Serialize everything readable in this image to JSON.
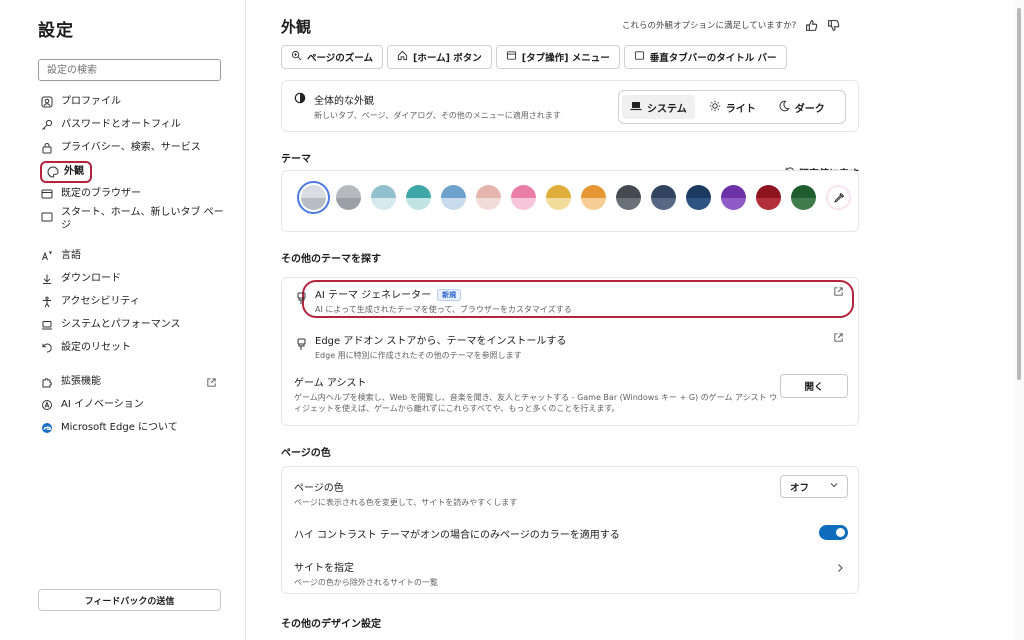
{
  "sidebar": {
    "title": "設定",
    "search_placeholder": "設定の検索",
    "items": [
      {
        "label": "プロファイル",
        "icon": "profile-icon"
      },
      {
        "label": "パスワードとオートフィル",
        "icon": "key-icon"
      },
      {
        "label": "プライバシー、検索、サービス",
        "icon": "lock-icon"
      },
      {
        "label": "外観",
        "icon": "palette-icon"
      },
      {
        "label": "既定のブラウザー",
        "icon": "browser-icon"
      },
      {
        "label": "スタート、ホーム、新しいタブ ページ",
        "icon": "home-tab-icon"
      },
      {
        "label": "言語",
        "icon": "language-icon"
      },
      {
        "label": "ダウンロード",
        "icon": "download-icon"
      },
      {
        "label": "アクセシビリティ",
        "icon": "accessibility-icon"
      },
      {
        "label": "システムとパフォーマンス",
        "icon": "laptop-icon"
      },
      {
        "label": "設定のリセット",
        "icon": "reset-icon"
      },
      {
        "label": "拡張機能",
        "icon": "puzzle-icon"
      },
      {
        "label": "AI イノベーション",
        "icon": "ai-icon"
      },
      {
        "label": "Microsoft Edge について",
        "icon": "edge-logo-icon"
      }
    ],
    "feedback_label": "フィードバックの送信"
  },
  "main": {
    "title": "外観",
    "satisfaction_text": "これらの外観オプションに満足していますか?",
    "toolbar": [
      "ページのズーム",
      "[ホーム] ボタン",
      "[タブ操作] メニュー",
      "垂直タブバーのタイトル バー"
    ],
    "overall": {
      "label": "全体的な外観",
      "sub": "新しいタブ、ページ、ダイアログ、その他のメニューに適用されます",
      "options": [
        "システム",
        "ライト",
        "ダーク"
      ],
      "selected": "システム"
    },
    "theme": {
      "title": "テーマ",
      "reset_label": "既定値に戻す",
      "swatches": [
        {
          "top": "#d9dde2",
          "bottom": "#b7bdc4"
        },
        {
          "top": "#b6b9bd",
          "bottom": "#9ba0a6"
        },
        {
          "top": "#93c0ce",
          "bottom": "#d6e9ef"
        },
        {
          "top": "#3fa7a8",
          "bottom": "#c1e3e3"
        },
        {
          "top": "#6ea2cc",
          "bottom": "#c8dcee"
        },
        {
          "top": "#e4b5ae",
          "bottom": "#f2dcd8"
        },
        {
          "top": "#e97ea7",
          "bottom": "#f6c6d8"
        },
        {
          "top": "#dfae3a",
          "bottom": "#f2dc9c"
        },
        {
          "top": "#e69733",
          "bottom": "#f6cd94"
        },
        {
          "top": "#454a50",
          "bottom": "#6a7078"
        },
        {
          "top": "#33445e",
          "bottom": "#566884"
        },
        {
          "top": "#1c3a5f",
          "bottom": "#2f5482"
        },
        {
          "top": "#6d31a8",
          "bottom": "#8f5cc7"
        },
        {
          "top": "#8e1420",
          "bottom": "#b3303a"
        },
        {
          "top": "#1f5c2e",
          "bottom": "#3f7d4c"
        }
      ]
    },
    "more_themes": {
      "title": "その他のテーマを探す",
      "ai": {
        "label": "AI テーマ ジェネレーター",
        "badge": "新規",
        "sub": "AI によって生成されたテーマを使って、ブラウザーをカスタマイズする"
      },
      "store": {
        "label": "Edge アドオン ストアから、テーマをインストールする",
        "sub": "Edge 用に特別に作成されたその他のテーマを参照します"
      },
      "game": {
        "label": "ゲーム アシスト",
        "sub": "ゲーム内ヘルプを検索し、Web を閲覧し、音楽を聞き、友人とチャットする - Game Bar (Windows キー + G) のゲーム アシスト ウィジェットを使えば、ゲームから離れずにこれらすべてや、もっと多くのことを行えます。",
        "button": "開く"
      }
    },
    "page_color": {
      "title": "ページの色",
      "color": {
        "label": "ページの色",
        "sub": "ページに表示される色を変更して、サイトを読みやすくします",
        "value": "オフ"
      },
      "high_contrast": {
        "label": "ハイ コントラスト テーマがオンの場合にのみページのカラーを適用する",
        "on": true
      },
      "sites": {
        "label": "サイトを指定",
        "sub": "ページの色から除外されるサイトの一覧"
      }
    },
    "other_design": {
      "title": "その他のデザイン設定"
    }
  }
}
